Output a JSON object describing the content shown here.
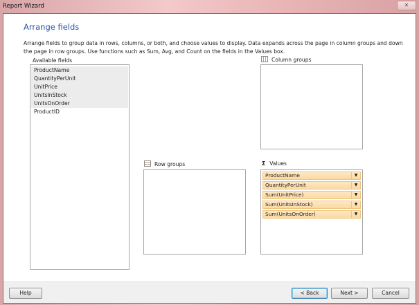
{
  "window": {
    "title": "Report Wizard",
    "close_icon": "close-icon"
  },
  "heading": "Arrange fields",
  "description": "Arrange fields to group data in rows, columns, or both, and choose values to display. Data expands across the page in column groups and down the page in row groups.  Use functions such as Sum, Avg, and Count on the fields in the Values box.",
  "available": {
    "label": "Available fields",
    "items": [
      {
        "label": "ProductName",
        "selected": true
      },
      {
        "label": "QuantityPerUnit",
        "selected": true
      },
      {
        "label": "UnitPrice",
        "selected": true
      },
      {
        "label": "UnitsInStock",
        "selected": true
      },
      {
        "label": "UnitsOnOrder",
        "selected": true
      },
      {
        "label": "ProductID",
        "selected": false
      }
    ]
  },
  "column_groups": {
    "label": "Column groups",
    "items": []
  },
  "row_groups": {
    "label": "Row groups",
    "items": []
  },
  "values": {
    "label": "Values",
    "icon": "Σ",
    "items": [
      "ProductName",
      "QuantityPerUnit",
      "Sum(UnitPrice)",
      "Sum(UnitsInStock)",
      "Sum(UnitsOnOrder)"
    ],
    "dropdown_glyph": "▼"
  },
  "buttons": {
    "help": "Help",
    "back": "< Back",
    "next": "Next >",
    "cancel": "Cancel"
  },
  "colors": {
    "heading": "#2a52a8",
    "value_item": "#fbd9a2"
  }
}
